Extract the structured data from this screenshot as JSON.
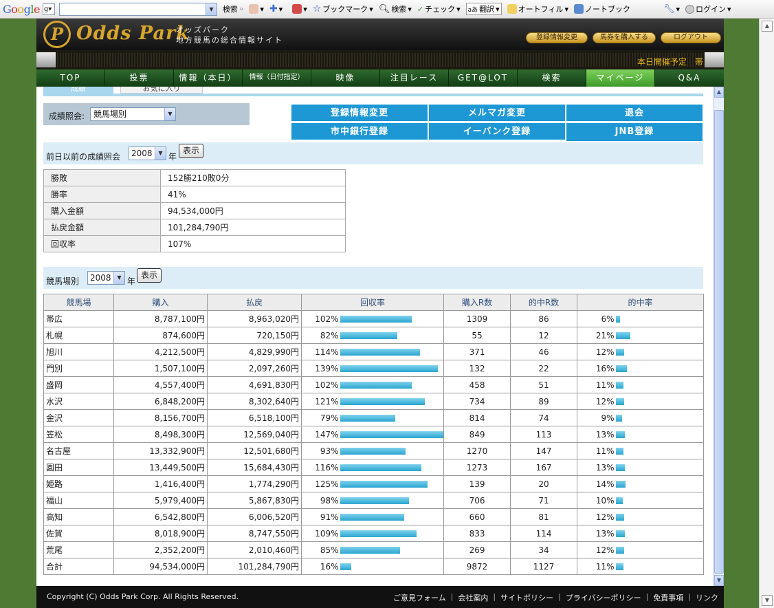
{
  "google_toolbar": {
    "logo": "Google",
    "search_value": "",
    "items": [
      "検索",
      "ブックマーク",
      "検索",
      "チェック",
      "翻訳",
      "オートフィル",
      "ノートブック",
      "ログイン"
    ]
  },
  "header": {
    "logo_mark": "P",
    "logo_text": "Odds Park",
    "sub_line1": "オッズパーク",
    "sub_line2": "地方競馬の総合情報サイト",
    "buttons": {
      "register_change": "登録情報変更",
      "buy_tickets": "馬券を購入する",
      "logout": "ログアウト"
    },
    "ticker": "本日開催予定　帯"
  },
  "nav": [
    "TOP",
    "投票",
    "情報（本日）",
    "情報（日付指定）",
    "映像",
    "注目レース",
    "GET@LOT",
    "検索",
    "マイページ",
    "Q&A"
  ],
  "tabs": {
    "results": "成績",
    "favorites": "お気に入り"
  },
  "inquiry": {
    "label": "成績照会:",
    "selected": "競馬場別"
  },
  "actions": {
    "register_change": "登録情報変更",
    "mailmag_change": "メルマガ変更",
    "withdraw": "退会",
    "bank_register": "市中銀行登録",
    "ebank_register": "イーバンク登録",
    "jnb_register": "JNB登録"
  },
  "previous": {
    "label": "前日以前の成績照会",
    "year": "2008",
    "unit": "年",
    "button": "表示"
  },
  "summary": [
    {
      "key": "勝敗",
      "value": "152勝210敗0分"
    },
    {
      "key": "勝率",
      "value": "41%"
    },
    {
      "key": "購入金額",
      "value": "94,534,000円"
    },
    {
      "key": "払戻金額",
      "value": "101,284,790円"
    },
    {
      "key": "回収率",
      "value": "107%"
    }
  ],
  "by_track": {
    "label": "競馬場別",
    "year": "2008",
    "unit": "年",
    "button": "表示"
  },
  "table": {
    "headers": [
      "競馬場",
      "購入",
      "払戻",
      "回収率",
      "購入R数",
      "的中R数",
      "的中率"
    ],
    "rows": [
      {
        "track": "帯広",
        "purchase": "8,787,100円",
        "payout": "8,963,020円",
        "recovery": "102%",
        "races": "1309",
        "hits": "86",
        "hit_rate": "6%"
      },
      {
        "track": "札幌",
        "purchase": "874,600円",
        "payout": "720,150円",
        "recovery": "82%",
        "races": "55",
        "hits": "12",
        "hit_rate": "21%"
      },
      {
        "track": "旭川",
        "purchase": "4,212,500円",
        "payout": "4,829,990円",
        "recovery": "114%",
        "races": "371",
        "hits": "46",
        "hit_rate": "12%"
      },
      {
        "track": "門別",
        "purchase": "1,507,100円",
        "payout": "2,097,260円",
        "recovery": "139%",
        "races": "132",
        "hits": "22",
        "hit_rate": "16%"
      },
      {
        "track": "盛岡",
        "purchase": "4,557,400円",
        "payout": "4,691,830円",
        "recovery": "102%",
        "races": "458",
        "hits": "51",
        "hit_rate": "11%"
      },
      {
        "track": "水沢",
        "purchase": "6,848,200円",
        "payout": "8,302,640円",
        "recovery": "121%",
        "races": "734",
        "hits": "89",
        "hit_rate": "12%"
      },
      {
        "track": "金沢",
        "purchase": "8,156,700円",
        "payout": "6,518,100円",
        "recovery": "79%",
        "races": "814",
        "hits": "74",
        "hit_rate": "9%"
      },
      {
        "track": "笠松",
        "purchase": "8,498,300円",
        "payout": "12,569,040円",
        "recovery": "147%",
        "races": "849",
        "hits": "113",
        "hit_rate": "13%"
      },
      {
        "track": "名古屋",
        "purchase": "13,332,900円",
        "payout": "12,501,680円",
        "recovery": "93%",
        "races": "1270",
        "hits": "147",
        "hit_rate": "11%"
      },
      {
        "track": "園田",
        "purchase": "13,449,500円",
        "payout": "15,684,430円",
        "recovery": "116%",
        "races": "1273",
        "hits": "167",
        "hit_rate": "13%"
      },
      {
        "track": "姫路",
        "purchase": "1,416,400円",
        "payout": "1,774,290円",
        "recovery": "125%",
        "races": "139",
        "hits": "20",
        "hit_rate": "14%"
      },
      {
        "track": "福山",
        "purchase": "5,979,400円",
        "payout": "5,867,830円",
        "recovery": "98%",
        "races": "706",
        "hits": "71",
        "hit_rate": "10%"
      },
      {
        "track": "高知",
        "purchase": "6,542,800円",
        "payout": "6,006,520円",
        "recovery": "91%",
        "races": "660",
        "hits": "81",
        "hit_rate": "12%"
      },
      {
        "track": "佐賀",
        "purchase": "8,018,900円",
        "payout": "8,747,550円",
        "recovery": "109%",
        "races": "833",
        "hits": "114",
        "hit_rate": "13%"
      },
      {
        "track": "荒尾",
        "purchase": "2,352,200円",
        "payout": "2,010,460円",
        "recovery": "85%",
        "races": "269",
        "hits": "34",
        "hit_rate": "12%"
      },
      {
        "track": "合計",
        "purchase": "94,534,000円",
        "payout": "101,284,790円",
        "recovery": "16%",
        "races": "9872",
        "hits": "1127",
        "hit_rate": "11%"
      }
    ]
  },
  "footer": {
    "copyright": "Copyright (C) Odds Park Corp. All Rights Reserved.",
    "links": [
      "ご意見フォーム",
      "会社案内",
      "サイトポリシー",
      "プライバシーポリシー",
      "免責事項",
      "リンク"
    ]
  },
  "colors": {
    "bar": "#2aa6d0",
    "action_button": "#1e98d4",
    "nav_active": "#5fb83f",
    "brand_gold": "#d6a62c"
  }
}
